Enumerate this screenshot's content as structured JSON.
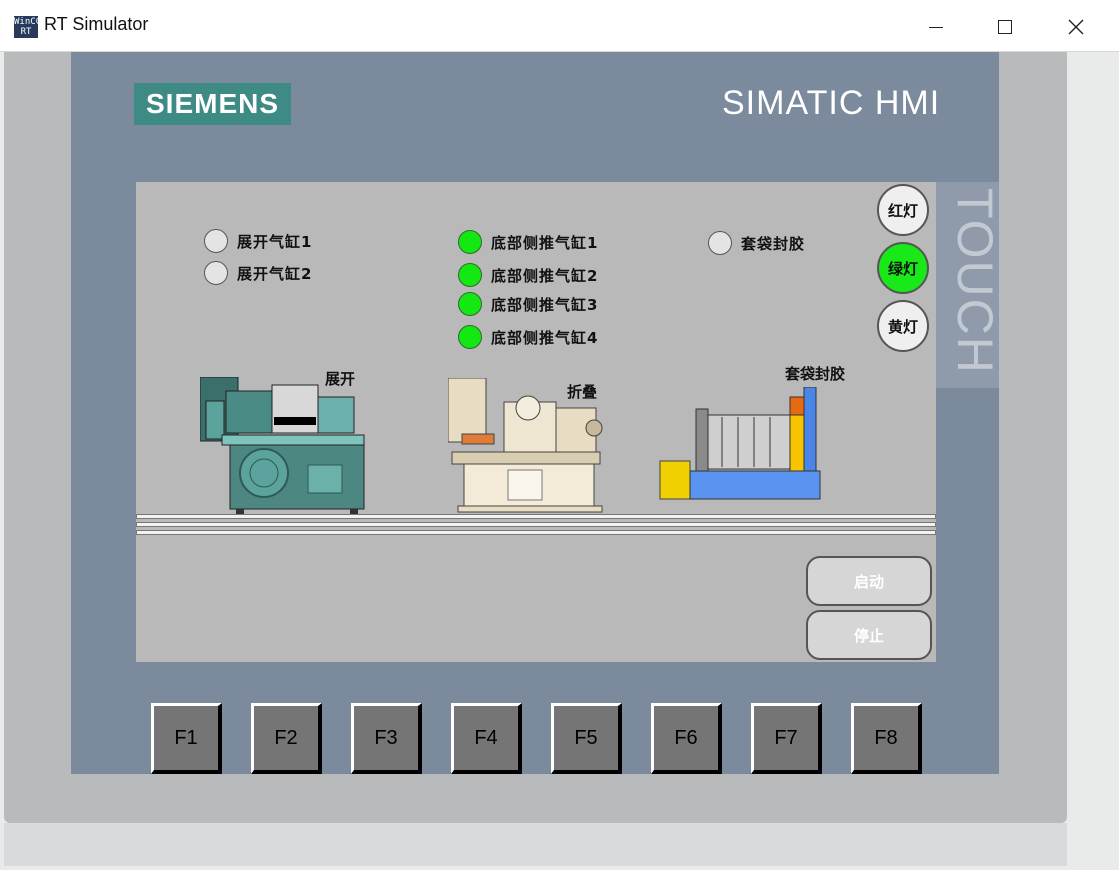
{
  "window": {
    "app_icon_line1": "WinCC",
    "app_icon_line2": "RT",
    "title": "RT Simulator"
  },
  "device": {
    "brand_logo": "SIEMENS",
    "product": "SIMATIC HMI",
    "touch_label": "TOUCH"
  },
  "indicators": [
    {
      "label": "展开气缸1",
      "on": false
    },
    {
      "label": "展开气缸2",
      "on": false
    },
    {
      "label": "底部侧推气缸1",
      "on": true
    },
    {
      "label": "底部侧推气缸2",
      "on": true
    },
    {
      "label": "底部侧推气缸3",
      "on": true
    },
    {
      "label": "底部侧推气缸4",
      "on": true
    },
    {
      "label": "套袋封胶",
      "on": false
    }
  ],
  "lights": {
    "red": "红灯",
    "green": "绿灯",
    "yellow": "黄灯",
    "active": "green"
  },
  "machines": {
    "unfold": "展开",
    "fold": "折叠",
    "bag_seal": "套袋封胶"
  },
  "commands": {
    "start": "启动",
    "stop": "停止"
  },
  "function_keys": [
    "F1",
    "F2",
    "F3",
    "F4",
    "F5",
    "F6",
    "F7",
    "F8"
  ],
  "colors": {
    "lamp_on": "#13e813",
    "lamp_off": "#e4e4e4",
    "logo": "#3e8b86",
    "bezel": "#7b8a9c"
  }
}
